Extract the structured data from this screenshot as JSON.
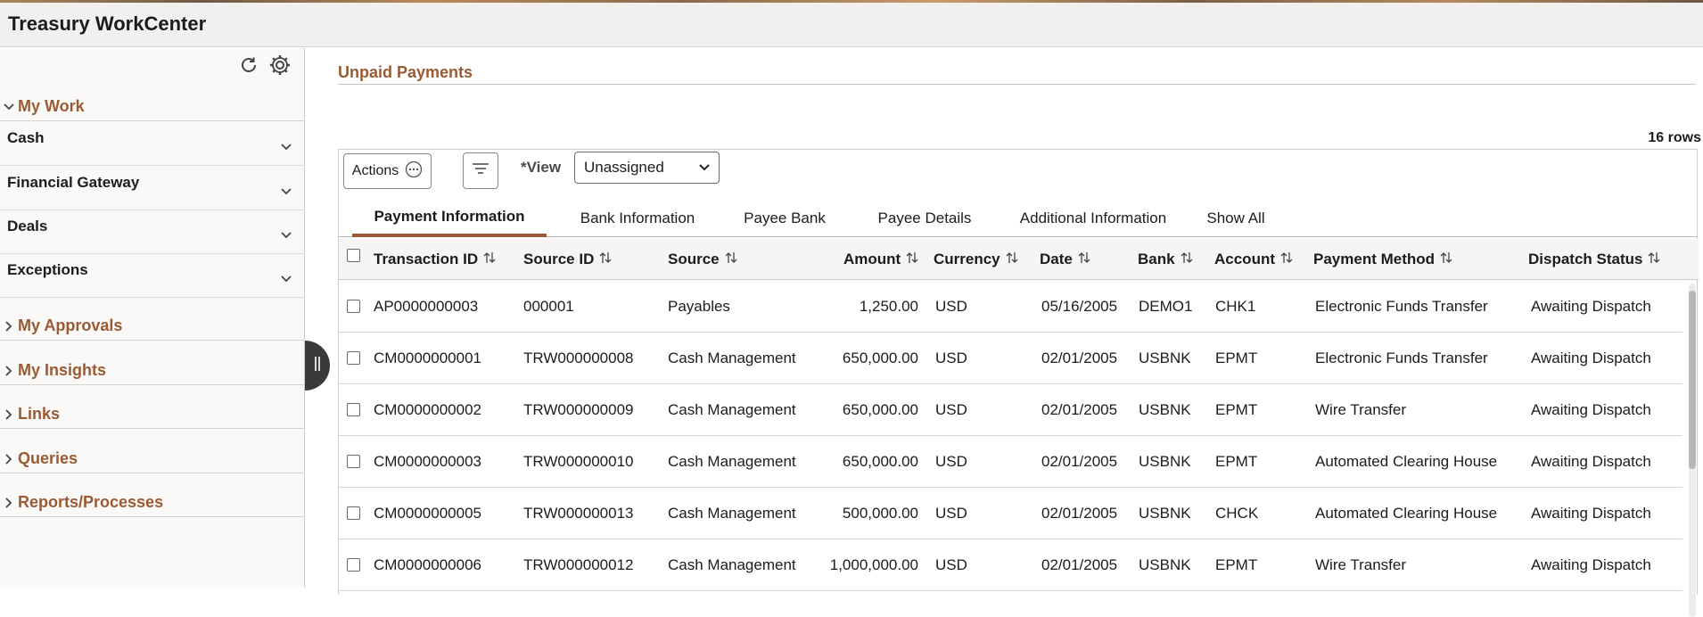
{
  "app": {
    "title": "Treasury WorkCenter"
  },
  "sidebar": {
    "my_work": {
      "label": "My Work",
      "items": [
        {
          "label": "Cash"
        },
        {
          "label": "Financial Gateway"
        },
        {
          "label": "Deals"
        },
        {
          "label": "Exceptions"
        }
      ]
    },
    "sections": [
      {
        "label": "My Approvals"
      },
      {
        "label": "My Insights"
      },
      {
        "label": "Links"
      },
      {
        "label": "Queries"
      },
      {
        "label": "Reports/Processes"
      }
    ]
  },
  "panel": {
    "title": "Unpaid Payments",
    "row_count": "16 rows",
    "actions_label": "Actions",
    "view_label": "*View",
    "view_value": "Unassigned"
  },
  "tabs": [
    {
      "label": "Payment Information",
      "active": true
    },
    {
      "label": "Bank Information"
    },
    {
      "label": "Payee Bank"
    },
    {
      "label": "Payee Details"
    },
    {
      "label": "Additional Information"
    },
    {
      "label": "Show All"
    }
  ],
  "table": {
    "columns": [
      "Transaction ID",
      "Source ID",
      "Source",
      "Amount",
      "Currency",
      "Date",
      "Bank",
      "Account",
      "Payment Method",
      "Dispatch Status"
    ],
    "rows": [
      [
        "AP0000000003",
        "000001",
        "Payables",
        "1,250.00",
        "USD",
        "05/16/2005",
        "DEMO1",
        "CHK1",
        "Electronic Funds Transfer",
        "Awaiting Dispatch"
      ],
      [
        "CM0000000001",
        "TRW000000008",
        "Cash Management",
        "650,000.00",
        "USD",
        "02/01/2005",
        "USBNK",
        "EPMT",
        "Electronic Funds Transfer",
        "Awaiting Dispatch"
      ],
      [
        "CM0000000002",
        "TRW000000009",
        "Cash Management",
        "650,000.00",
        "USD",
        "02/01/2005",
        "USBNK",
        "EPMT",
        "Wire Transfer",
        "Awaiting Dispatch"
      ],
      [
        "CM0000000003",
        "TRW000000010",
        "Cash Management",
        "650,000.00",
        "USD",
        "02/01/2005",
        "USBNK",
        "EPMT",
        "Automated Clearing House",
        "Awaiting Dispatch"
      ],
      [
        "CM0000000005",
        "TRW000000013",
        "Cash Management",
        "500,000.00",
        "USD",
        "02/01/2005",
        "USBNK",
        "CHCK",
        "Automated Clearing House",
        "Awaiting Dispatch"
      ],
      [
        "CM0000000006",
        "TRW000000012",
        "Cash Management",
        "1,000,000.00",
        "USD",
        "02/01/2005",
        "USBNK",
        "EPMT",
        "Wire Transfer",
        "Awaiting Dispatch"
      ]
    ]
  },
  "colors": {
    "accent": "#9a5a33",
    "header_bg": "#f2f0ee",
    "sidebar_bg": "#faf9f8",
    "handle": "#3a3a3a"
  }
}
